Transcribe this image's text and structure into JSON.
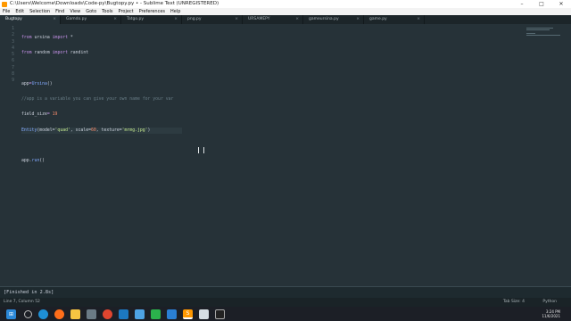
{
  "window": {
    "title": "C:\\Users\\Welcome\\Downloads\\Code-py\\Bugtopy.py • - Sublime Text (UNREGISTERED)"
  },
  "menu": [
    "File",
    "Edit",
    "Selection",
    "Find",
    "View",
    "Goto",
    "Tools",
    "Project",
    "Preferences",
    "Help"
  ],
  "tabs": [
    {
      "label": "Bugtopy",
      "active": true
    },
    {
      "label": "Gamdo.py",
      "active": false
    },
    {
      "label": "Tatgo.py",
      "active": false
    },
    {
      "label": "png.py",
      "active": false
    },
    {
      "label": "URSAMEPY",
      "active": false
    },
    {
      "label": "gameursina.py",
      "active": false
    },
    {
      "label": "game.py",
      "active": false
    }
  ],
  "code": {
    "line_numbers": [
      "1",
      "2",
      "3",
      "4",
      "5",
      "6",
      "7",
      "8",
      "9"
    ],
    "line1": {
      "kw1": "from",
      "mod": " ursina ",
      "kw2": "import",
      "rest": " *"
    },
    "line2": {
      "kw1": "from",
      "mod": " random ",
      "kw2": "import",
      "rest": " randint"
    },
    "line4": {
      "a": "app",
      "b": "=",
      "c": "Ursina",
      "d": "()"
    },
    "line5": {
      "text": "//app is a variable you can give your own name for your var"
    },
    "line6": {
      "a": "field_size",
      "b": "= ",
      "c": "19"
    },
    "line7": {
      "a": "Entity",
      "b": "(model=",
      "c": "'quad'",
      "d": ", scale=",
      "e": "60",
      "f": ", texture=",
      "g": "'mrmg.jpg'",
      "h": ")"
    },
    "line9": {
      "a": "app.",
      "b": "run",
      "c": "()"
    }
  },
  "output": {
    "text": "[Finished in 2.8s]"
  },
  "status": {
    "position": "Line 7, Column 52",
    "tab_size": "Tab Size: 4",
    "syntax": "Python"
  },
  "taskbar": {
    "icons": [
      "start-icon",
      "search-icon",
      "edge-icon",
      "firefox-icon",
      "folder-icon",
      "tile-icon",
      "chrome-icon",
      "vscode-icon",
      "cloud-icon",
      "green-app-icon",
      "arrow-app-icon",
      "sublime-icon",
      "image-viewer-icon",
      "terminal-icon"
    ],
    "time": "3:24 PM",
    "date": "11/6/2021"
  },
  "colors": {
    "editor_bg": "#263238",
    "keyword": "#c792ea",
    "function": "#82aaff",
    "string": "#c3e88d",
    "number": "#f78c6c",
    "comment": "#697d86"
  }
}
